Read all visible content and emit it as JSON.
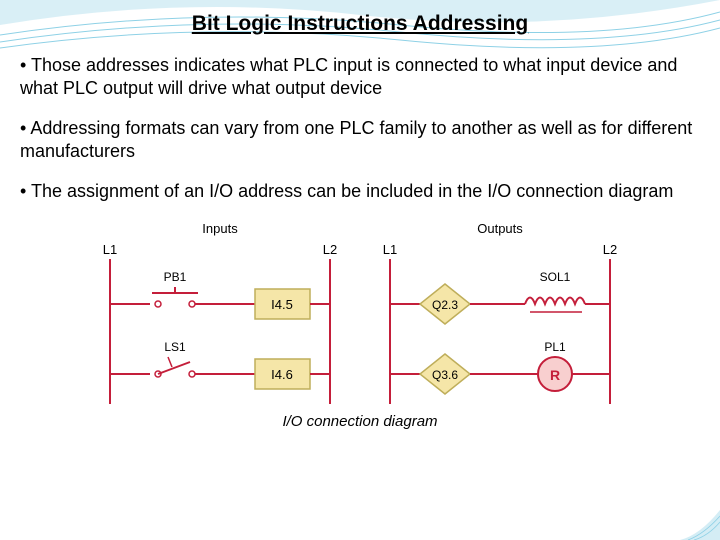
{
  "title": "Bit Logic Instructions Addressing",
  "bullets": [
    "Those addresses indicates what PLC input is connected to what input device and what PLC output will drive what output device",
    "Addressing formats can vary from one PLC family to another as well as for different manufacturers",
    "The assignment of an I/O address can be included in the I/O connection diagram"
  ],
  "diagram": {
    "header_inputs": "Inputs",
    "header_outputs": "Outputs",
    "left_rail1": "L1",
    "right_rail1": "L2",
    "left_rail2": "L1",
    "right_rail2": "L2",
    "pb_label": "PB1",
    "ls_label": "LS1",
    "input_addr1": "I4.5",
    "input_addr2": "I4.6",
    "output_addr1": "Q2.3",
    "output_addr2": "Q3.6",
    "sol_label": "SOL1",
    "pl_label": "PL1",
    "pl_inner": "R"
  },
  "caption": "I/O connection diagram"
}
